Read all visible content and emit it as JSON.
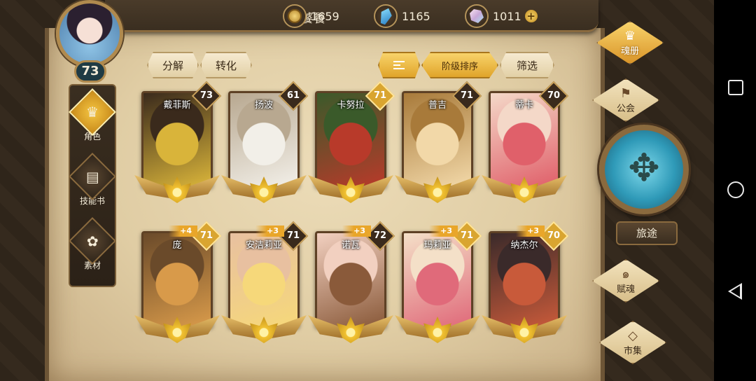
{
  "player": {
    "name": "饕餮",
    "level": "73"
  },
  "currency": [
    {
      "icon": "gold-coin-icon",
      "value": "1659"
    },
    {
      "icon": "blue-gem-icon",
      "value": "1165"
    },
    {
      "icon": "soul-crystal-icon",
      "value": "1011"
    }
  ],
  "add_label": "+",
  "left_tabs": [
    {
      "label": "角色",
      "icon": "character-icon",
      "active": true
    },
    {
      "label": "技能书",
      "icon": "skill-book-icon",
      "active": false
    },
    {
      "label": "素材",
      "icon": "material-icon",
      "active": false
    }
  ],
  "filters": {
    "decompose": "分解",
    "convert": "转化",
    "sort_by_tier": "阶级排序",
    "filter": "筛选"
  },
  "heroes": [
    {
      "name": "戴菲斯",
      "level": "73",
      "bonus": "",
      "level_gold": false,
      "art": [
        "#d9b43a",
        "#3a2a1c"
      ]
    },
    {
      "name": "扬波",
      "level": "61",
      "bonus": "",
      "level_gold": false,
      "art": [
        "#f2efe8",
        "#b8a890"
      ]
    },
    {
      "name": "卡努拉",
      "level": "71",
      "bonus": "",
      "level_gold": true,
      "art": [
        "#b83a2a",
        "#3a5a2a"
      ]
    },
    {
      "name": "普吉",
      "level": "71",
      "bonus": "",
      "level_gold": false,
      "art": [
        "#f2d8a8",
        "#a87a3a"
      ]
    },
    {
      "name": "蒂卡",
      "level": "70",
      "bonus": "",
      "level_gold": false,
      "art": [
        "#e0606a",
        "#f4d8c8"
      ]
    },
    {
      "name": "庞",
      "level": "71",
      "bonus": "+4",
      "level_gold": true,
      "art": [
        "#d89a4a",
        "#6a4a2a"
      ]
    },
    {
      "name": "安洁莉亚",
      "level": "71",
      "bonus": "+3",
      "level_gold": false,
      "art": [
        "#f6d87a",
        "#e8c0a0"
      ]
    },
    {
      "name": "诺瓦",
      "level": "72",
      "bonus": "+3",
      "level_gold": false,
      "art": [
        "#8a5a3a",
        "#f2d0c0"
      ]
    },
    {
      "name": "玛莉亚",
      "level": "71",
      "bonus": "+3",
      "level_gold": true,
      "art": [
        "#e06a7a",
        "#f4e0c8"
      ]
    },
    {
      "name": "纳杰尔",
      "level": "70",
      "bonus": "+3",
      "level_gold": true,
      "art": [
        "#c85a3a",
        "#3a2a2a"
      ]
    }
  ],
  "right_menu": {
    "soul_book": "魂册",
    "guild": "公会",
    "journey": "旅途",
    "soul_gift": "赋魂",
    "market": "市集"
  },
  "colors": {
    "accent_gold": "#e9a62a",
    "parchment": "#e0cda4",
    "frame_brown": "#6d5536"
  }
}
